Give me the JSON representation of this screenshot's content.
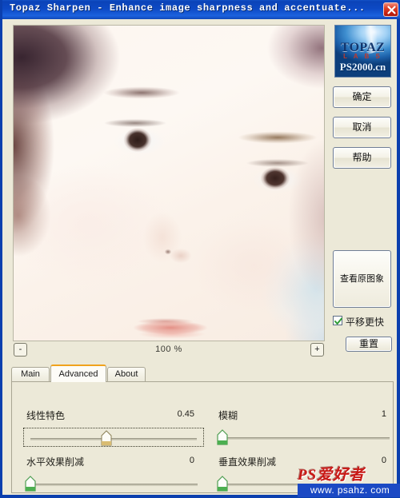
{
  "window": {
    "title": "Topaz Sharpen - Enhance image sharpness and accentuate...",
    "close_label": "close-icon",
    "accent_color": "#0b43b8",
    "panel_color": "#ece9d8"
  },
  "preview": {
    "zoom_out_label": "-",
    "zoom_in_label": "+",
    "zoom_level": "100 %"
  },
  "tabs": [
    {
      "label": "Main",
      "active": false
    },
    {
      "label": "Advanced",
      "active": true
    },
    {
      "label": "About",
      "active": false
    }
  ],
  "controls": [
    {
      "label": "线性特色",
      "value": "0.45",
      "pos_pct": 45,
      "style": "gold",
      "focused": true
    },
    {
      "label": "模糊",
      "value": "1",
      "pos_pct": 0,
      "style": "green",
      "focused": false
    },
    {
      "label": "水平效果削减",
      "value": "0",
      "pos_pct": 0,
      "style": "green",
      "focused": false
    },
    {
      "label": "垂直效果削减",
      "value": "0",
      "pos_pct": 0,
      "style": "green",
      "focused": false
    }
  ],
  "sidebar": {
    "logo": {
      "brand": "TOPAZ",
      "sub": "L A B S",
      "overlay": "PS2000.cn"
    },
    "ok_label": "确定",
    "cancel_label": "取消",
    "help_label": "帮助",
    "view_original_label": "查看原图象",
    "pan_faster_label": "平移更快",
    "pan_faster_checked": true,
    "reset_label": "重置"
  },
  "watermark": {
    "brand": "PS爱好者",
    "url": "www. psahz. com",
    "brand_color": "#c91a16",
    "url_bg": "#1b49c4"
  }
}
